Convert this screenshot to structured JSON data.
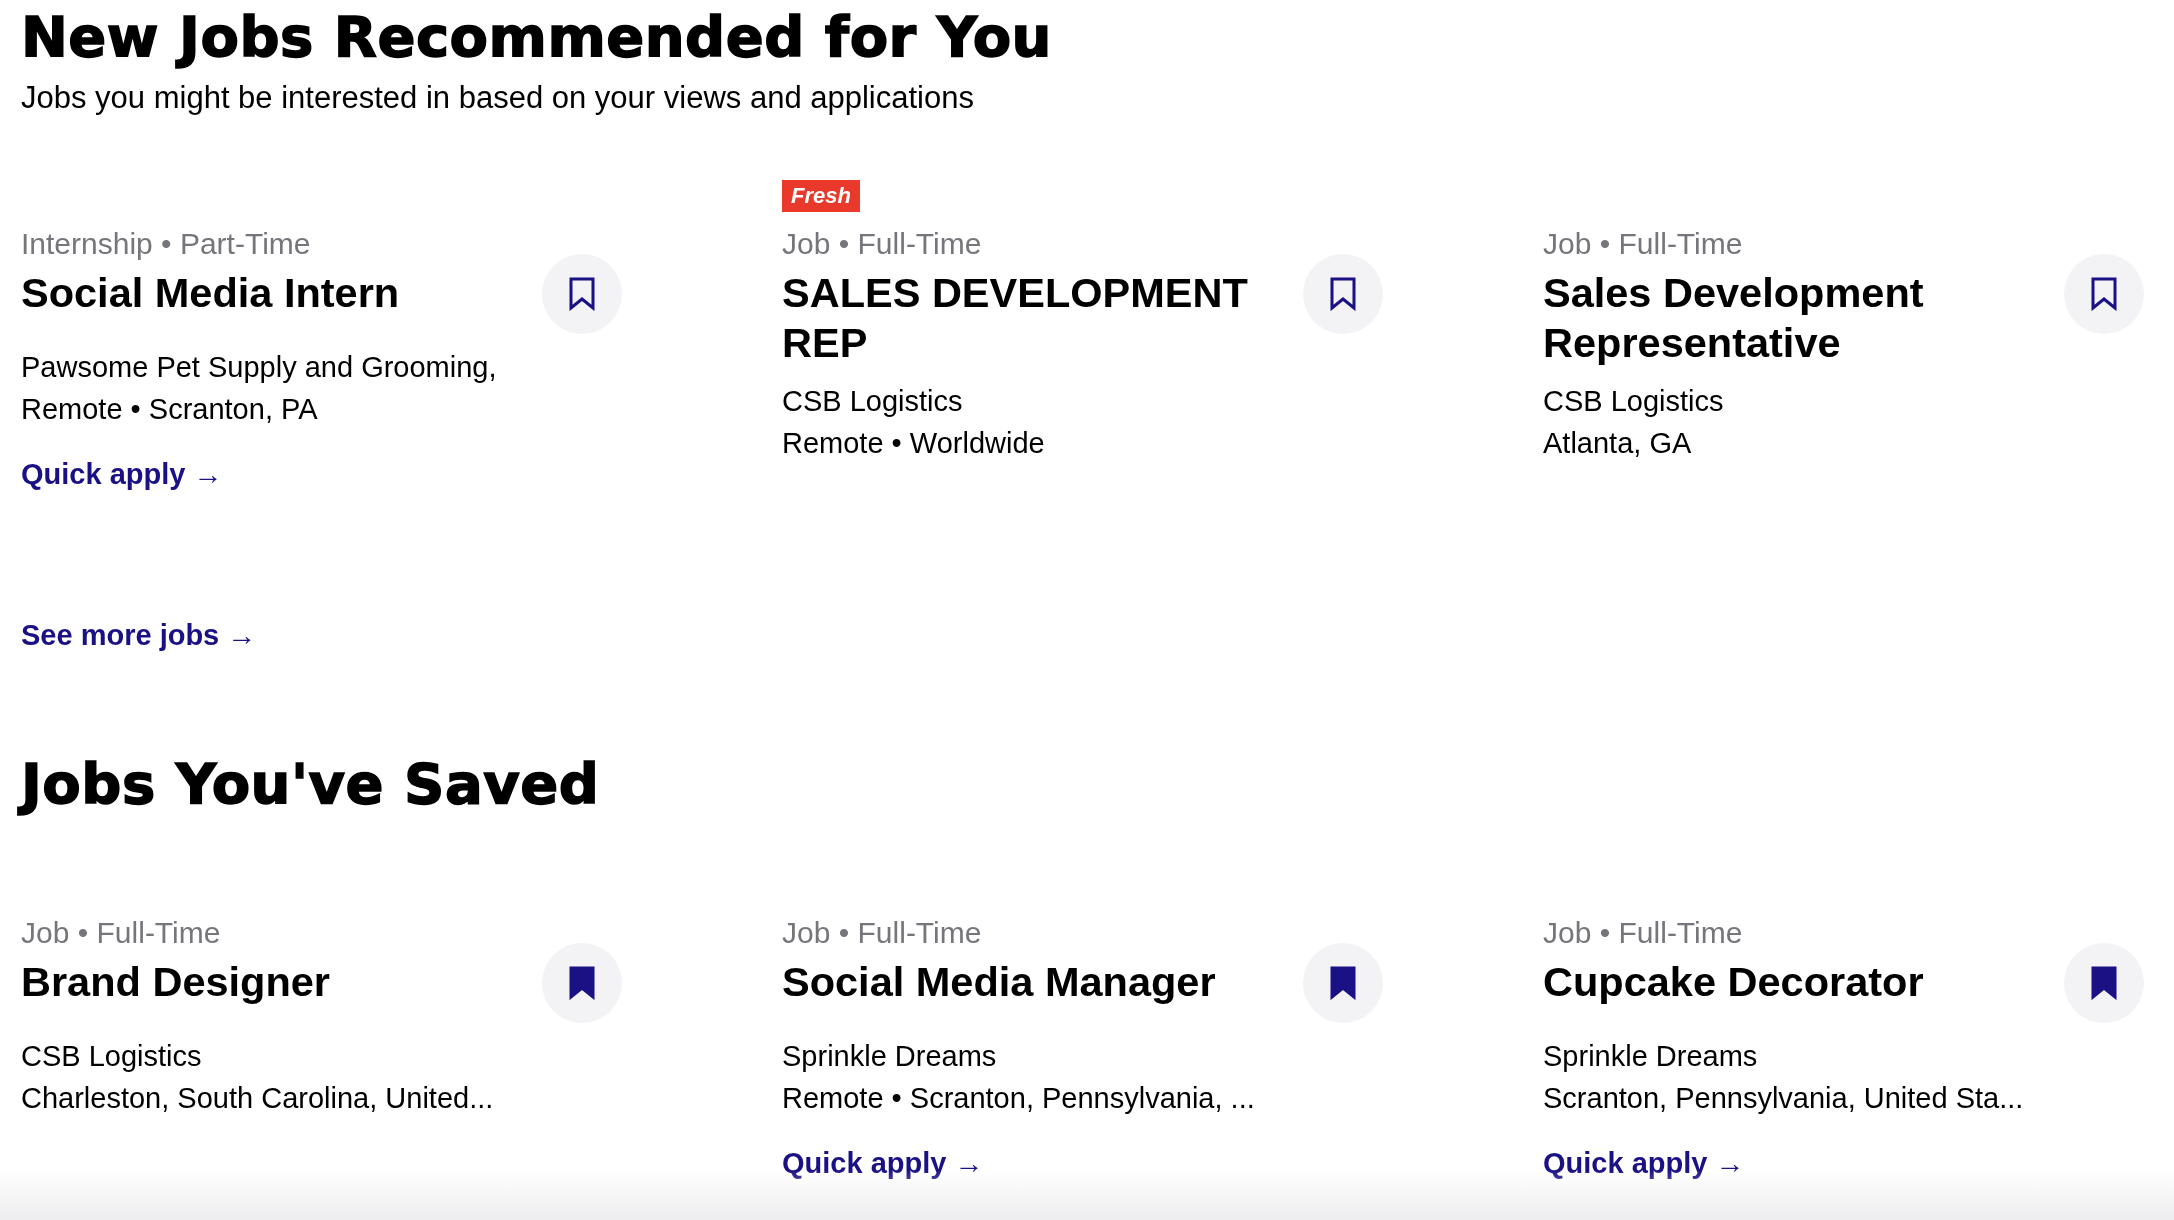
{
  "sections": [
    {
      "title": "New Jobs Recommended for You",
      "subtitle": "Jobs you might be interested in based on your views and applications",
      "jobs": [
        {
          "meta": "Internship • Part-Time",
          "title": "Social Media Intern",
          "details": [
            "Pawsome Pet Supply and Grooming,",
            "Remote • Scranton, PA"
          ],
          "saved": false,
          "action": "Quick apply →"
        },
        {
          "badge": "Fresh",
          "meta": "Job • Full-Time",
          "title": "SALES DEVELOPMENT REP",
          "details": [
            "CSB Logistics",
            "Remote • Worldwide"
          ],
          "saved": false
        },
        {
          "meta": "Job • Full-Time",
          "title": "Sales Development Representative",
          "details": [
            "CSB Logistics",
            "Atlanta, GA"
          ],
          "saved": false
        }
      ],
      "more": "See more jobs →"
    },
    {
      "title": "Jobs You've Saved",
      "jobs": [
        {
          "meta": "Job • Full-Time",
          "title": "Brand Designer",
          "details": [
            "CSB Logistics",
            "Charleston, South Carolina, United..."
          ],
          "saved": true
        },
        {
          "meta": "Job • Full-Time",
          "title": "Social Media Manager",
          "details": [
            "Sprinkle Dreams",
            "Remote • Scranton, Pennsylvania, ..."
          ],
          "saved": true,
          "action": "Quick apply →"
        },
        {
          "meta": "Job • Full-Time",
          "title": "Cupcake Decorator",
          "details": [
            "Sprinkle Dreams",
            "Scranton, Pennsylvania, United Sta..."
          ],
          "saved": true,
          "action": "Quick apply →"
        }
      ]
    }
  ]
}
